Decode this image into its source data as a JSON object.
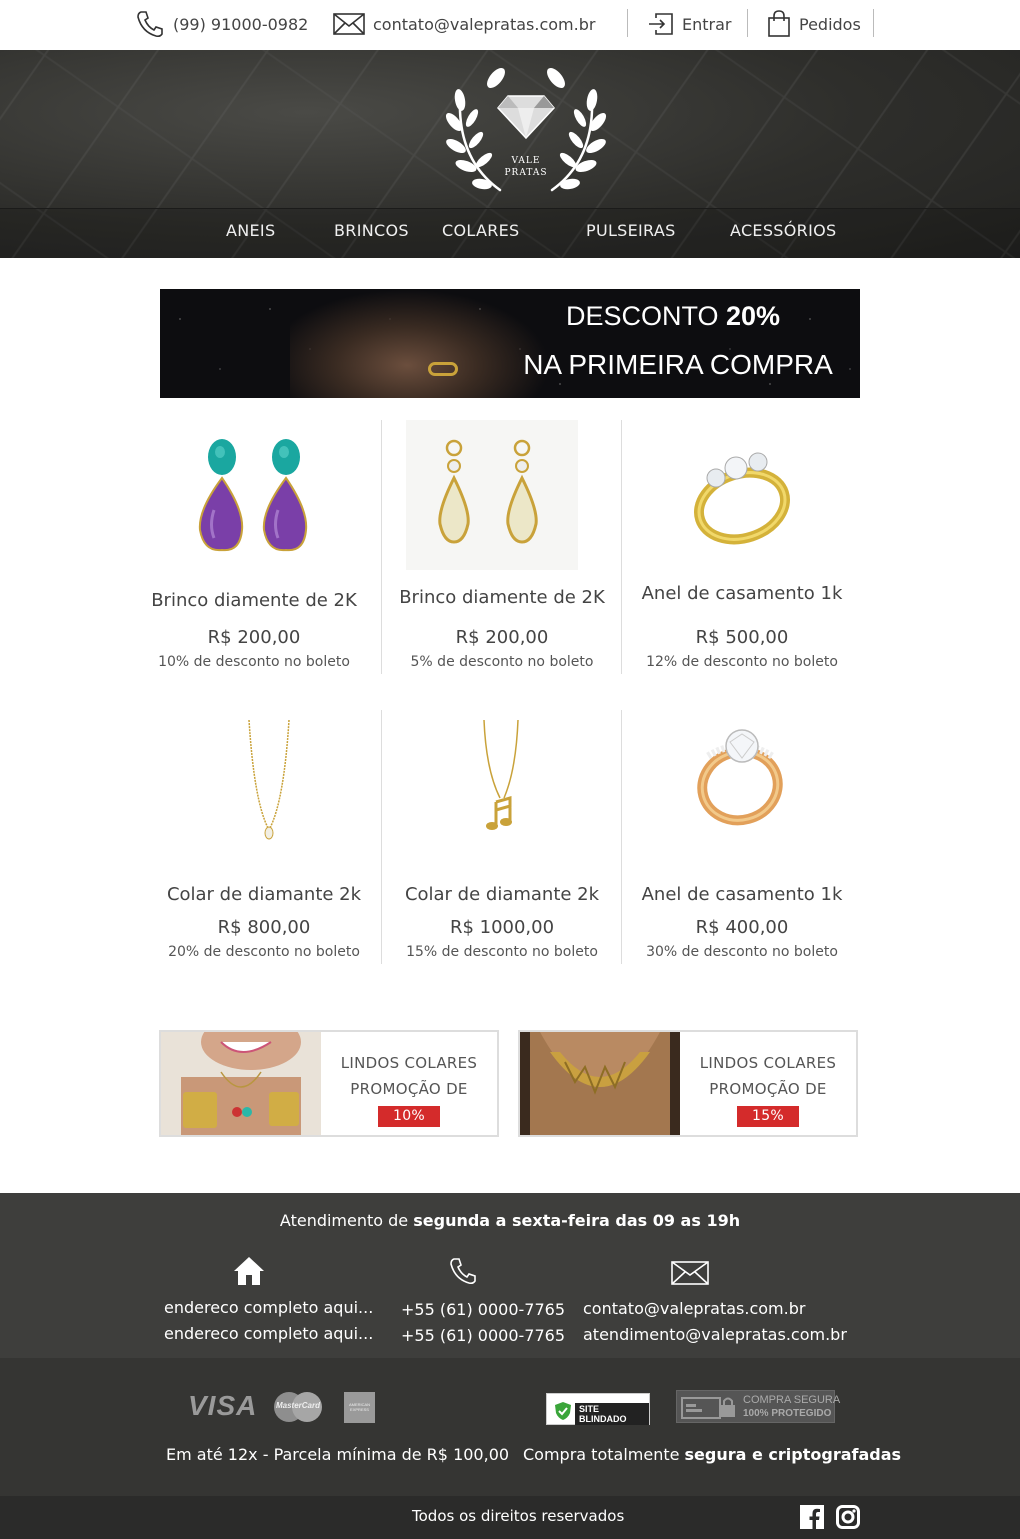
{
  "topbar": {
    "phone": "(99) 91000-0982",
    "email": "contato@valepratas.com.br",
    "login": "Entrar",
    "orders": "Pedidos"
  },
  "logo": {
    "line1": "VALE",
    "line2": "PRATAS"
  },
  "nav": [
    "ANEIS",
    "BRINCOS",
    "COLARES",
    "PULSEIRAS",
    "ACESSÓRIOS"
  ],
  "banner": {
    "line1_prefix": "DESCONTO ",
    "line1_value": "20%",
    "line2": "NA PRIMEIRA COMPRA"
  },
  "products": [
    {
      "name": "Brinco diamente de 2K",
      "price": "R$ 200,00",
      "discount": "10% de desconto no boleto",
      "icon": "amethyst-earrings"
    },
    {
      "name": "Brinco diamente de 2K",
      "price": "R$ 200,00",
      "discount": "5% de desconto no boleto",
      "icon": "gold-drop-earrings"
    },
    {
      "name": "Anel de casamento 1k",
      "price": "R$ 500,00",
      "discount": "12% de desconto no boleto",
      "icon": "gold-ring"
    },
    {
      "name": "Colar de diamante 2k",
      "price": "R$ 800,00",
      "discount": "20% de desconto no boleto",
      "icon": "pendant-necklace"
    },
    {
      "name": "Colar de diamante 2k",
      "price": "R$ 1000,00",
      "discount": "15% de desconto no boleto",
      "icon": "music-note-necklace"
    },
    {
      "name": "Anel de casamento 1k",
      "price": "R$ 400,00",
      "discount": "30% de desconto no boleto",
      "icon": "rose-gold-ring"
    }
  ],
  "promos": [
    {
      "line1": "LINDOS COLARES",
      "line2": "PROMOÇÃO DE",
      "badge": "10%"
    },
    {
      "line1": "LINDOS COLARES",
      "line2": "PROMOÇÃO DE",
      "badge": "15%"
    }
  ],
  "footer": {
    "hours_prefix": "Atendimento de ",
    "hours_bold": "segunda a sexta-feira das 09 as 19h",
    "address": [
      "endereco completo aqui...",
      "endereco completo aqui..."
    ],
    "phones": [
      "+55 (61) 0000-7765",
      "+55 (61) 0000-7765"
    ],
    "emails": [
      "contato@valepratas.com.br",
      "atendimento@valepratas.com.br"
    ],
    "payment": {
      "visa": "VISA",
      "mastercard": "MasterCard",
      "amex": "AMERICAN EXPRESS",
      "installments": "Em até 12x - Parcela mínima de R$ 100,00"
    },
    "security": {
      "blindado": "SITE BLINDADO",
      "secure1": "COMPRA SEGURA",
      "secure2": "100% PROTEGIDO",
      "text_prefix": "Compra totalmente ",
      "text_bold": "segura e criptografadas"
    },
    "copyright": "Todos os direitos reservados"
  },
  "colors": {
    "promo_badge": "#d42b2b",
    "footer_bg": "#3e3e3c",
    "gold": "#c9a23a"
  }
}
